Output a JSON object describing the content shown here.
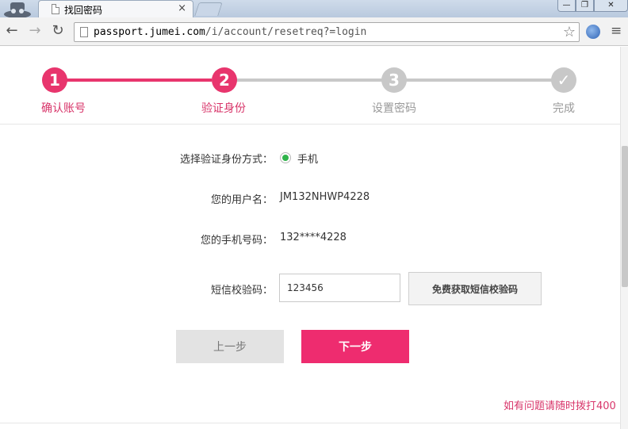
{
  "browser": {
    "tab_title": "找回密码",
    "tab_close": "×",
    "url_host": "passport.jumei.com",
    "url_path": "/i/account/resetreq?=login",
    "back_glyph": "←",
    "forward_glyph": "→",
    "reload_glyph": "↻",
    "star_glyph": "☆",
    "menu_glyph": "≡",
    "min_glyph": "—",
    "max_glyph": "❐",
    "close_glyph": "✕"
  },
  "steps": [
    {
      "number": "1",
      "label": "确认账号",
      "state": "done"
    },
    {
      "number": "2",
      "label": "验证身份",
      "state": "current"
    },
    {
      "number": "3",
      "label": "设置密码",
      "state": "todo"
    },
    {
      "number": "✓",
      "label": "完成",
      "state": "todo"
    }
  ],
  "form": {
    "method_label": "选择验证身份方式：",
    "method_option": "手机",
    "method_selected": true,
    "username_label": "您的用户名：",
    "username_value": "JM132NHWP4228",
    "phone_label": "您的手机号码：",
    "phone_value": "132****4228",
    "sms_label": "短信校验码：",
    "sms_value": "123456",
    "sms_button": "免费获取短信校验码"
  },
  "actions": {
    "prev": "上一步",
    "next": "下一步"
  },
  "help_text": "如有问题请随时拨打400",
  "colors": {
    "accent": "#e8356d",
    "next_button": "#ee2c6f",
    "inactive": "#c8c8c8",
    "radio_selected": "#2fb34a"
  }
}
